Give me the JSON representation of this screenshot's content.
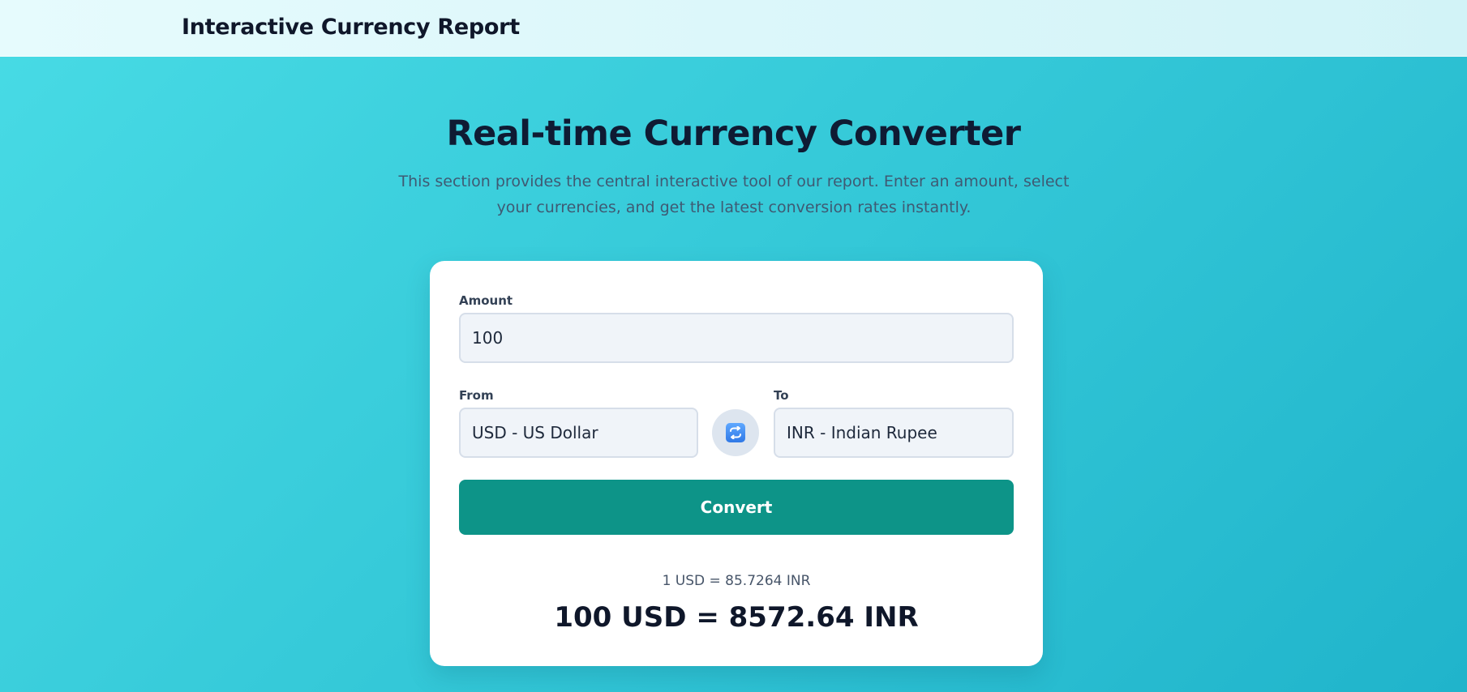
{
  "header": {
    "title": "Interactive Currency Report"
  },
  "hero": {
    "title": "Real-time Currency Converter",
    "subtitle": "This section provides the central interactive tool of our report. Enter an amount, select your currencies, and get the latest conversion rates instantly."
  },
  "converter": {
    "amount_label": "Amount",
    "amount_value": "100",
    "from_label": "From",
    "from_value": "USD - US Dollar",
    "to_label": "To",
    "to_value": "INR - Indian Rupee",
    "swap_icon": "swap-arrows-icon",
    "convert_label": "Convert",
    "rate_text": "1 USD = 85.7264 INR",
    "result_text": "100 USD = 8572.64 INR"
  },
  "colors": {
    "accent": "#0d9488",
    "swap_icon": "#2f78e6",
    "title": "#0f1b33"
  }
}
